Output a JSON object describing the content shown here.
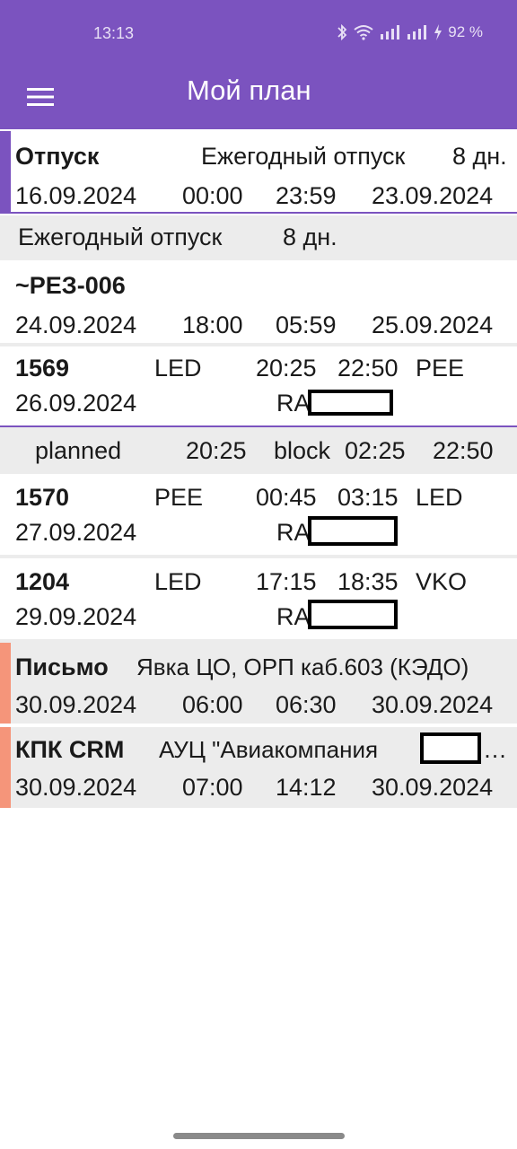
{
  "status_bar": {
    "time": "13:13",
    "battery": "92 %"
  },
  "app_bar": {
    "title": "Мой план",
    "menu_icon": "hamburger-menu-icon",
    "color": "#7b53bf"
  },
  "items": {
    "vacation": {
      "type": "Отпуск",
      "desc": "Ежегодный отпуск",
      "days": "8 дн.",
      "date_start": "16.09.2024",
      "time_start": "00:00",
      "time_end": "23:59",
      "date_end": "23.09.2024",
      "accent": "#7b53bf"
    },
    "vacation_summary": {
      "desc": "Ежегодный отпуск",
      "days": "8 дн."
    },
    "reserve": {
      "code": "~РЕЗ-006",
      "date_start": "24.09.2024",
      "time_start": "18:00",
      "time_end": "05:59",
      "date_end": "25.09.2024"
    },
    "flight_1569": {
      "number": "1569",
      "from": "LED",
      "dep": "20:25",
      "arr": "22:50",
      "to": "PEE",
      "date": "26.09.2024",
      "aircraft_prefix": "RA"
    },
    "planned": {
      "label": "planned",
      "dep": "20:25",
      "block_label": "block",
      "block": "02:25",
      "arr": "22:50"
    },
    "flight_1570": {
      "number": "1570",
      "from": "PEE",
      "dep": "00:45",
      "arr": "03:15",
      "to": "LED",
      "date": "27.09.2024",
      "aircraft_prefix": "RA"
    },
    "flight_1204": {
      "number": "1204",
      "from": "LED",
      "dep": "17:15",
      "arr": "18:35",
      "to": "VKO",
      "date": "29.09.2024",
      "aircraft_prefix": "RA"
    },
    "letter": {
      "type": "Письмо",
      "desc": "Явка ЦО, ОРП каб.603 (КЭДО)",
      "date_start": "30.09.2024",
      "time_start": "06:00",
      "time_end": "06:30",
      "date_end": "30.09.2024",
      "accent": "#f5957a"
    },
    "training": {
      "type": "КПК CRM",
      "desc": "АУЦ \"Авиакомпания",
      "ellipsis": "…",
      "date_start": "30.09.2024",
      "time_start": "07:00",
      "time_end": "14:12",
      "date_end": "30.09.2024",
      "accent": "#f5957a"
    }
  }
}
